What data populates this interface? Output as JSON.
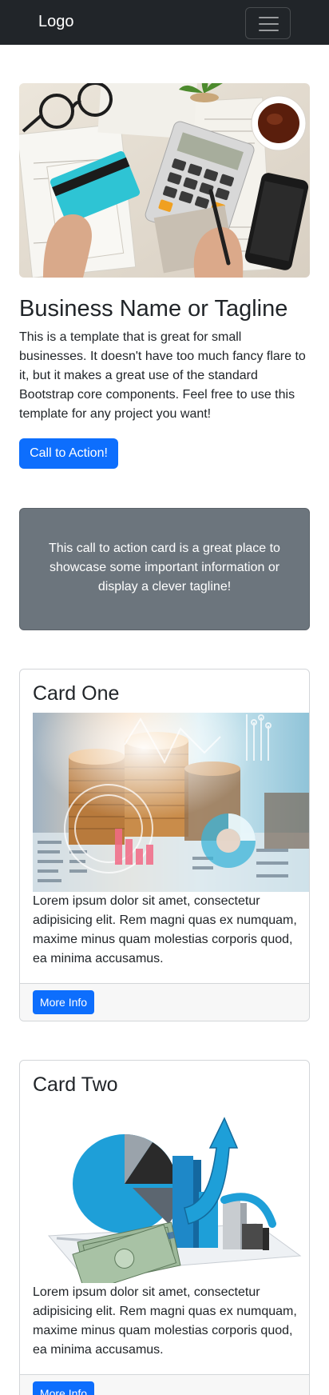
{
  "navbar": {
    "logo": "Logo",
    "menu_icon": "hamburger-menu-icon"
  },
  "hero": {
    "image": "office-desk-photo",
    "title": "Business Name or Tagline",
    "text": "This is a template that is great for small businesses. It doesn't have too much fancy flare to it, but it makes a great use of the standard Bootstrap core components. Feel free to use this template for any project you want!",
    "button": "Call to Action!"
  },
  "cta_card": {
    "text": "This call to action card is a great place to showcase some important information or display a clever tagline!"
  },
  "cards": [
    {
      "title": "Card One",
      "image": "finance-coins-chart-photo",
      "text": "Lorem ipsum dolor sit amet, consectetur adipisicing elit. Rem magni quas ex numquam, maxime minus quam molestias corporis quod, ea minima accusamus.",
      "button": "More Info"
    },
    {
      "title": "Card Two",
      "image": "3d-growth-chart-illustration",
      "text": "Lorem ipsum dolor sit amet, consectetur adipisicing elit. Rem magni quas ex numquam, maxime minus quam molestias corporis quod, ea minima accusamus.",
      "button": "More Info"
    }
  ],
  "colors": {
    "navbar": "#212529",
    "primary": "#0d6efd",
    "secondary": "#6c757d"
  }
}
